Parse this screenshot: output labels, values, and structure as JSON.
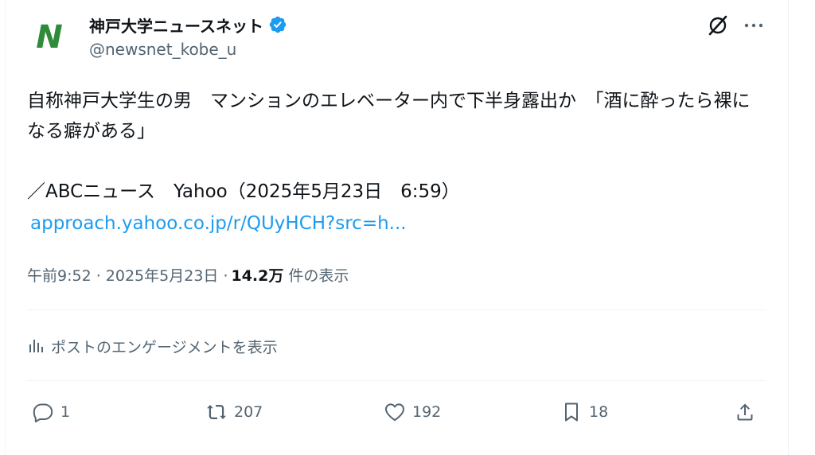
{
  "account": {
    "display_name": "神戸大学ニュースネット",
    "handle": "@newsnet_kobe_u",
    "avatar_letter": "N",
    "avatar_color": "#2e8b3a",
    "verified_color": "#1d9bf0"
  },
  "tweet": {
    "text": "自称神戸大学生の男　マンションのエレベーター内で下半身露出か　「酒に酔ったら裸になる癖がある」\n\n／ABCニュース　Yahoo（2025年5月23日　6:59）",
    "link": "approach.yahoo.co.jp/r/QUyHCH?src=h...",
    "timestamp": "午前9:52 · 2025年5月23日 · ",
    "views_count": "14.2万",
    "views_label": "件の表示"
  },
  "engagement_link": "ポストのエンゲージメントを表示",
  "actions": {
    "replies": "1",
    "reposts": "207",
    "likes": "192",
    "bookmarks": "18"
  },
  "colors": {
    "text": "#0f1419",
    "secondary": "#536471",
    "link": "#1d9bf0",
    "divider": "#eff3f4"
  }
}
